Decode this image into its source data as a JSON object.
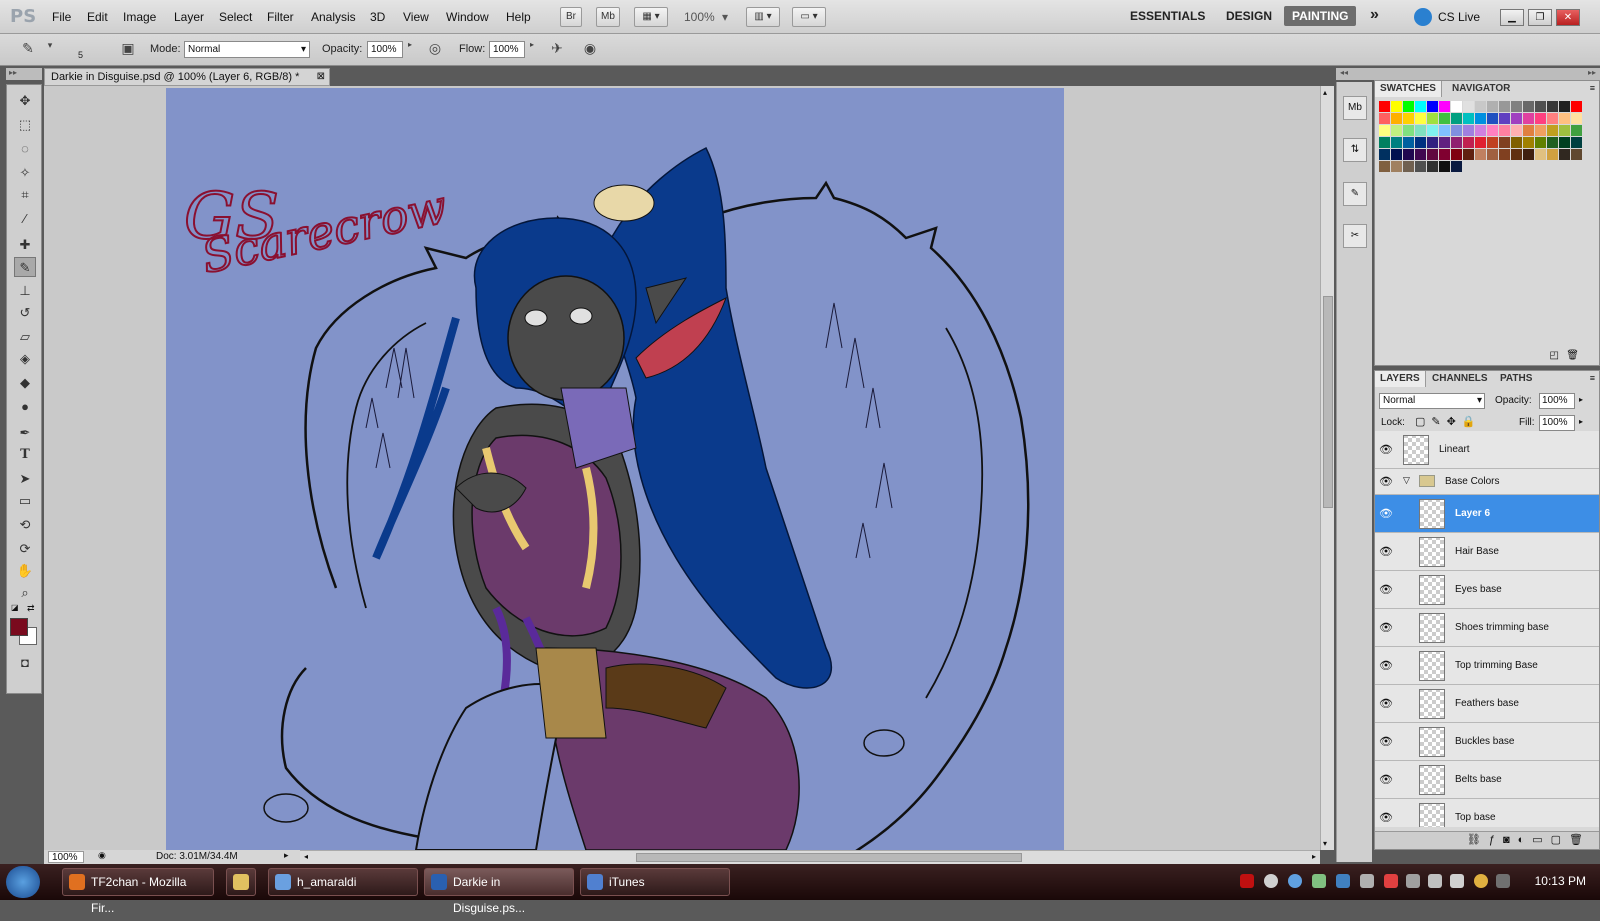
{
  "app": {
    "logo": "PS",
    "menu": [
      "File",
      "Edit",
      "Image",
      "Layer",
      "Select",
      "Filter",
      "Analysis",
      "3D",
      "View",
      "Window",
      "Help"
    ],
    "bridge_btn": "Br",
    "mini_bridge_btn": "Mb",
    "zoom_menu": "100%",
    "workspaces": [
      "ESSENTIALS",
      "DESIGN",
      "PAINTING"
    ],
    "active_workspace": "PAINTING",
    "more": "»",
    "cslive": "CS Live"
  },
  "options_bar": {
    "brush_size": "5",
    "mode_label": "Mode:",
    "mode_value": "Normal",
    "opacity_label": "Opacity:",
    "opacity_value": "100%",
    "flow_label": "Flow:",
    "flow_value": "100%"
  },
  "document": {
    "tab_title": "Darkie in Disguise.psd @ 100% (Layer 6, RGB/8) *",
    "zoom": "100%",
    "doc_size": "Doc: 3.01M/34.4M",
    "signature": "GS Scarecrow",
    "colors": {
      "canvas": "#8293c9",
      "hair": "#0a3a8c",
      "skin": "#4a4a4a",
      "dress": "#6b3a6b",
      "lineart": "#111111",
      "signature": "#8a1030"
    }
  },
  "tools": [
    "move",
    "marquee",
    "lasso",
    "quick-select",
    "crop",
    "eyedropper",
    "healing",
    "brush",
    "stamp",
    "history-brush",
    "eraser",
    "paint-bucket",
    "blur",
    "dodge",
    "pen",
    "type",
    "path-select",
    "shape",
    "3d-rotate",
    "3d-orbit",
    "hand",
    "zoom"
  ],
  "foreground_color": "#7a0a1e",
  "background_color": "#ffffff",
  "swatches_panel": {
    "tabs": [
      "SWATCHES",
      "NAVIGATOR"
    ]
  },
  "swatches": [
    "#ff0000",
    "#ffff00",
    "#00ff00",
    "#00ffff",
    "#0000ff",
    "#ff00ff",
    "#ffffff",
    "#e0e0e0",
    "#c8c8c8",
    "#b0b0b0",
    "#989898",
    "#808080",
    "#686868",
    "#505050",
    "#383838",
    "#202020",
    "#ff0000",
    "#ff6060",
    "#ffb000",
    "#ffd000",
    "#ffff40",
    "#a0e040",
    "#40c040",
    "#00a080",
    "#00c0c0",
    "#0090e0",
    "#2050c0",
    "#6040c0",
    "#a040c0",
    "#e040a0",
    "#ff4080",
    "#ff8080",
    "#ffc080",
    "#ffe0a0",
    "#ffff80",
    "#c0f080",
    "#80e080",
    "#80e0c0",
    "#80f0f0",
    "#80c0ff",
    "#8090e0",
    "#a080e0",
    "#d080e0",
    "#ff80c0",
    "#ff80a0",
    "#ffb0b0",
    "#e08040",
    "#f0a060",
    "#c0a020",
    "#a0c040",
    "#40a040",
    "#008060",
    "#008080",
    "#0060a0",
    "#003080",
    "#302080",
    "#602080",
    "#902070",
    "#c02050",
    "#e02030",
    "#c04020",
    "#804020",
    "#806000",
    "#a08000",
    "#608000",
    "#206020",
    "#004020",
    "#004040",
    "#003060",
    "#001050",
    "#200850",
    "#400850",
    "#600840",
    "#800030",
    "#800010",
    "#602010",
    "#c08060",
    "#a06040",
    "#804020",
    "#603010",
    "#402010",
    "#e0c080",
    "#d0a040",
    "#302820",
    "#604830",
    "#806040",
    "#a08060",
    "#706050",
    "#505050",
    "#303030",
    "#101010",
    "#0a1a40"
  ],
  "layers_panel": {
    "tabs": [
      "LAYERS",
      "CHANNELS",
      "PATHS"
    ],
    "blend_mode": "Normal",
    "opacity_label": "Opacity:",
    "opacity_value": "100%",
    "lock_label": "Lock:",
    "fill_label": "Fill:",
    "fill_value": "100%",
    "layers": [
      {
        "name": "Lineart",
        "type": "layer",
        "indent": false,
        "selected": false
      },
      {
        "name": "Base Colors",
        "type": "group",
        "indent": false,
        "selected": false
      },
      {
        "name": "Layer 6",
        "type": "layer",
        "indent": true,
        "selected": true
      },
      {
        "name": "Hair Base",
        "type": "layer",
        "indent": true,
        "selected": false
      },
      {
        "name": "Eyes base",
        "type": "layer",
        "indent": true,
        "selected": false
      },
      {
        "name": "Shoes trimming base",
        "type": "layer",
        "indent": true,
        "selected": false
      },
      {
        "name": "Top trimming Base",
        "type": "layer",
        "indent": true,
        "selected": false
      },
      {
        "name": "Feathers base",
        "type": "layer",
        "indent": true,
        "selected": false
      },
      {
        "name": "Buckles base",
        "type": "layer",
        "indent": true,
        "selected": false
      },
      {
        "name": "Belts base",
        "type": "layer",
        "indent": true,
        "selected": false
      },
      {
        "name": "Top base",
        "type": "layer",
        "indent": true,
        "selected": false
      }
    ]
  },
  "taskbar": {
    "tasks": [
      {
        "label": "TF2chan - Mozilla Fir...",
        "icon_color": "#e07020"
      },
      {
        "label": "",
        "icon_color": "#e0c060"
      },
      {
        "label": "h_amaraldi",
        "icon_color": "#6aa0e0"
      },
      {
        "label": "Darkie in Disguise.ps...",
        "icon_color": "#2a60b0"
      },
      {
        "label": "iTunes",
        "icon_color": "#5080d0"
      }
    ],
    "clock": "10:13 PM"
  }
}
